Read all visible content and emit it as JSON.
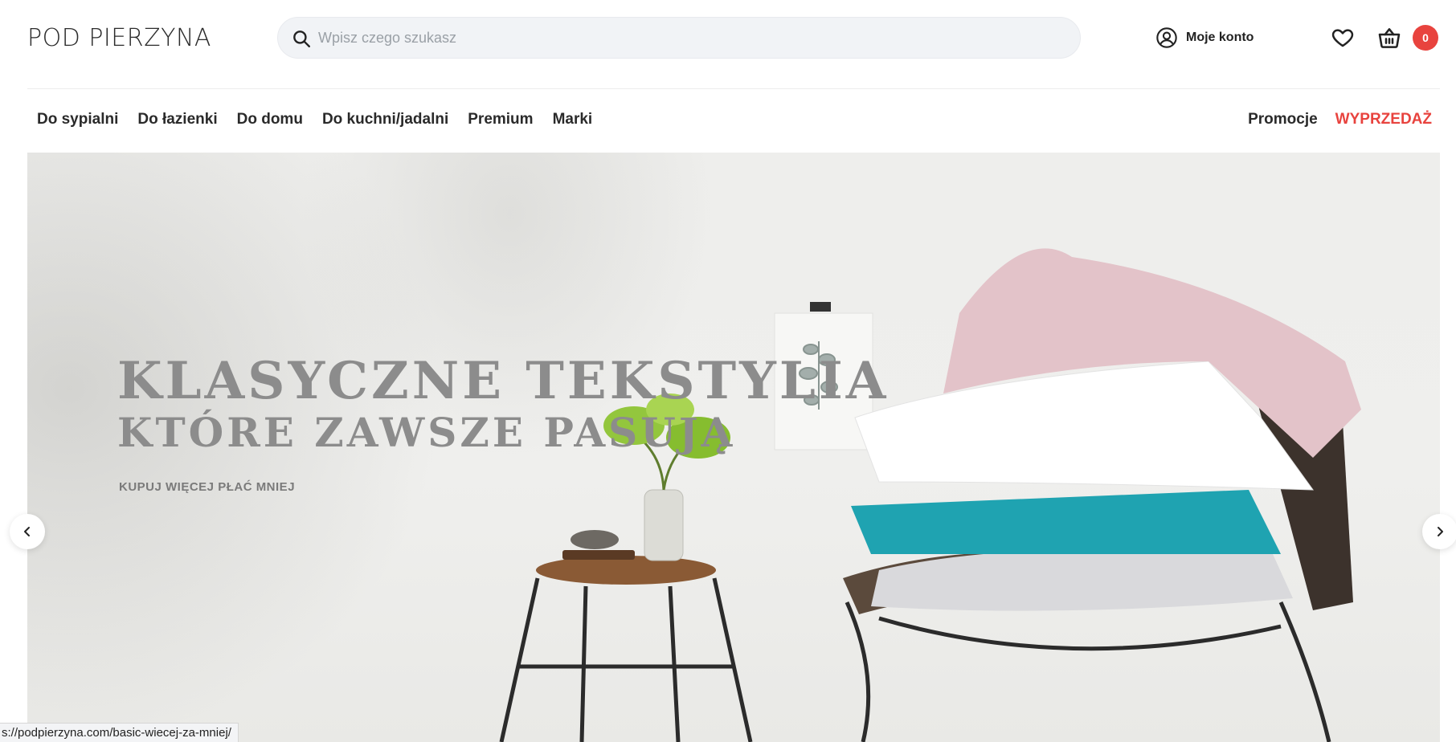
{
  "header": {
    "logo": "POD PIERZYNA",
    "search_placeholder": "Wpisz czego szukasz",
    "account_label": "Moje konto",
    "cart_count": "0"
  },
  "nav": {
    "items": [
      "Do sypialni",
      "Do łazienki",
      "Do domu",
      "Do kuchni/jadalni",
      "Premium",
      "Marki"
    ],
    "promo": "Promocje",
    "sale": "WYPRZEDAŻ"
  },
  "hero": {
    "title_line1": "KLASYCZNE TEKSTYLIA",
    "title_line2": "KTÓRE ZAWSZE PASUJĄ",
    "subtitle": "KUPUJ WIĘCEJ PŁAĆ MNIEJ"
  },
  "status_bar": "s://podpierzyna.com/basic-wiecej-za-mniej/",
  "colors": {
    "accent": "#e8433e",
    "search_bg": "#f1f3f6",
    "teal": "#1fa3b1",
    "pink": "#e3c3c9"
  }
}
